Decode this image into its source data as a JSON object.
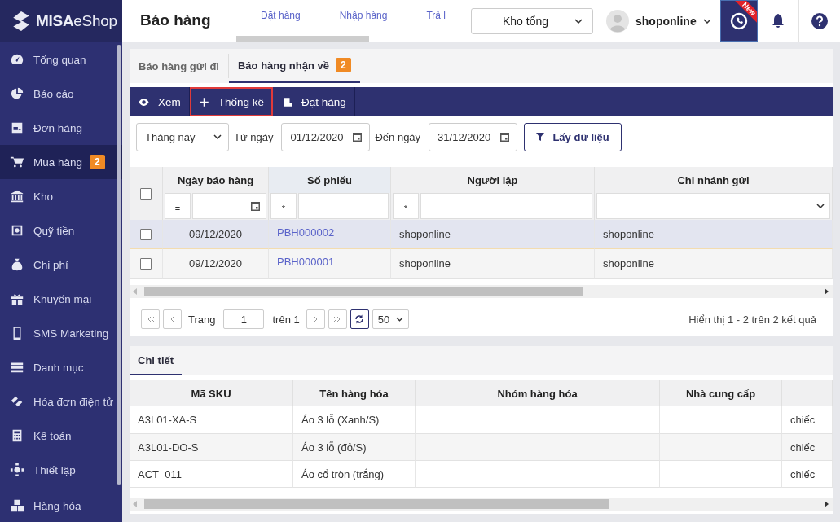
{
  "sidebar": {
    "logo": "MISA",
    "logo_suffix": "eShop",
    "items": [
      {
        "label": "Tổng quan",
        "selected": false
      },
      {
        "label": "Báo cáo",
        "selected": false
      },
      {
        "label": "Đơn hàng",
        "selected": false
      },
      {
        "label": "Mua hàng",
        "selected": true,
        "badge": "2"
      },
      {
        "label": "Kho",
        "selected": false
      },
      {
        "label": "Quỹ tiền",
        "selected": false
      },
      {
        "label": "Chi phí",
        "selected": false
      },
      {
        "label": "Khuyến mại",
        "selected": false
      },
      {
        "label": "SMS Marketing",
        "selected": false
      },
      {
        "label": "Danh mục",
        "selected": false
      },
      {
        "label": "Hóa đơn điện tử",
        "selected": false
      },
      {
        "label": "Kế toán",
        "selected": false
      },
      {
        "label": "Thiết lập",
        "selected": false
      }
    ],
    "footer": {
      "label": "Hàng hóa"
    }
  },
  "header": {
    "title": "Báo hàng",
    "nav": [
      "Đặt hàng",
      "Nhập hàng",
      "Trả l"
    ],
    "warehouse": "Kho tổng",
    "user": "shoponline",
    "new_badge": "New"
  },
  "tabs": [
    {
      "label": "Báo hàng gửi đi",
      "selected": false
    },
    {
      "label": "Báo hàng nhận về",
      "selected": true,
      "badge": "2"
    }
  ],
  "toolbar": [
    {
      "label": "Xem",
      "highlighted": false
    },
    {
      "label": "Thống kê",
      "highlighted": true
    },
    {
      "label": "Đặt hàng",
      "highlighted": false
    }
  ],
  "filter": {
    "period": "Tháng này",
    "from_label": "Từ ngày",
    "from": "01/12/2020",
    "to_label": "Đến ngày",
    "to": "31/12/2020",
    "button": "Lấy dữ liệu"
  },
  "table": {
    "all_checked": false,
    "columns": [
      "Ngày báo hàng",
      "Số phiếu",
      "Người lập",
      "Chi nhánh gửi"
    ],
    "filters": [
      {
        "kind": "date",
        "operator": "="
      },
      {
        "kind": "text",
        "operator": "*"
      },
      {
        "kind": "text",
        "operator": "*"
      },
      {
        "kind": "select"
      }
    ],
    "rows": [
      {
        "selected": true,
        "checked": false,
        "date": "09/12/2020",
        "number": "PBH000002",
        "creator": "shoponline",
        "branch": "shoponline"
      },
      {
        "selected": false,
        "checked": false,
        "date": "09/12/2020",
        "number": "PBH000001",
        "creator": "shoponline",
        "branch": "shoponline"
      }
    ]
  },
  "pagination": {
    "page_label": "Trang",
    "page": "1",
    "of": "trên 1",
    "page_size": "50",
    "summary": "Hiển thị 1 - 2 trên 2 kết quả"
  },
  "detail": {
    "tab": "Chi tiết",
    "columns": [
      "Mã SKU",
      "Tên hàng hóa",
      "Nhóm hàng hóa",
      "Nhà cung cấp"
    ],
    "rows": [
      {
        "sku": "A3L01-XA-S",
        "name": "Áo 3 lỗ (Xanh/S)",
        "unit": "chiếc"
      },
      {
        "sku": "A3L01-DO-S",
        "name": "Áo 3 lỗ (đỏ/S)",
        "unit": "chiếc"
      },
      {
        "sku": "ACT_011",
        "name": "Áo cổ tròn (trắng)",
        "unit": "chiếc"
      }
    ]
  }
}
